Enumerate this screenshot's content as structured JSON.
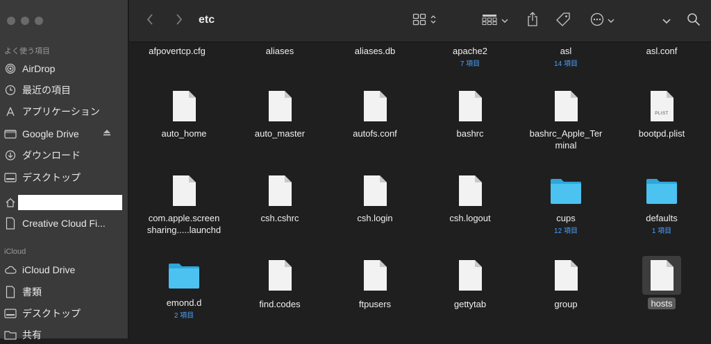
{
  "sidebar": {
    "favorites_title": "よく使う項目",
    "icloud_title": "iCloud",
    "items": [
      {
        "label": "AirDrop",
        "icon": "airdrop-icon"
      },
      {
        "label": "最近の項目",
        "icon": "clock-icon"
      },
      {
        "label": "アプリケーション",
        "icon": "applications-icon"
      },
      {
        "label": "Google Drive",
        "icon": "drive-icon"
      },
      {
        "label": "ダウンロード",
        "icon": "download-icon"
      },
      {
        "label": "デスクトップ",
        "icon": "desktop-icon"
      },
      {
        "label": "",
        "icon": "home-icon"
      },
      {
        "label": "Creative Cloud Fi...",
        "icon": "document-icon"
      }
    ],
    "icloud_items": [
      {
        "label": "iCloud Drive",
        "icon": "cloud-icon"
      },
      {
        "label": "書類",
        "icon": "document-icon"
      },
      {
        "label": "デスクトップ",
        "icon": "desktop-icon"
      },
      {
        "label": "共有",
        "icon": "shared-folder-icon"
      }
    ]
  },
  "toolbar": {
    "title": "etc"
  },
  "files": {
    "row0": [
      {
        "name": "afpovertcp.cfg",
        "sub": ""
      },
      {
        "name": "aliases",
        "sub": ""
      },
      {
        "name": "aliases.db",
        "sub": ""
      },
      {
        "name": "apache2",
        "sub": "7 項目"
      },
      {
        "name": "asl",
        "sub": "14 項目"
      },
      {
        "name": "asl.conf",
        "sub": ""
      }
    ],
    "row1": [
      {
        "name": "auto_home",
        "kind": "file"
      },
      {
        "name": "auto_master",
        "kind": "file"
      },
      {
        "name": "autofs.conf",
        "kind": "file"
      },
      {
        "name": "bashrc",
        "kind": "file"
      },
      {
        "name": "bashrc_Apple_Terminal",
        "line1": "bashrc_Apple_Ter",
        "line2": "minal",
        "kind": "file"
      },
      {
        "name": "bootpd.plist",
        "kind": "plist",
        "badge": "PLIST"
      }
    ],
    "row2": [
      {
        "name": "com.apple.screensharing.....launchd",
        "line1": "com.apple.screen",
        "line2": "sharing.....launchd",
        "kind": "file"
      },
      {
        "name": "csh.cshrc",
        "kind": "file"
      },
      {
        "name": "csh.login",
        "kind": "file"
      },
      {
        "name": "csh.logout",
        "kind": "file"
      },
      {
        "name": "cups",
        "sub": "12 項目",
        "kind": "folder"
      },
      {
        "name": "defaults",
        "sub": "1 項目",
        "kind": "folder"
      }
    ],
    "row3": [
      {
        "name": "emond.d",
        "sub": "2 項目",
        "kind": "folder"
      },
      {
        "name": "find.codes",
        "kind": "file"
      },
      {
        "name": "ftpusers",
        "kind": "file"
      },
      {
        "name": "gettytab",
        "kind": "file"
      },
      {
        "name": "group",
        "kind": "file"
      },
      {
        "name": "hosts",
        "kind": "file",
        "selected": true
      }
    ]
  },
  "colors": {
    "folder": "#4cc2f0",
    "accent": "#4aa3ff",
    "file": "#f2f2f2"
  }
}
